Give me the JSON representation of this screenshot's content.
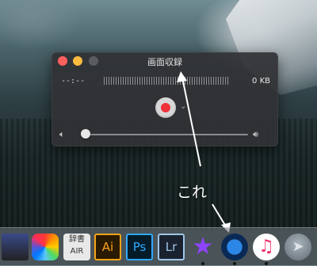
{
  "window": {
    "title": "画面収録",
    "time_display": "--:--",
    "file_size": "0 KB",
    "options_chevron": "⌄",
    "volume": 0.03
  },
  "annotation": {
    "label": "これ"
  },
  "dock": {
    "items": [
      {
        "icon": "screen-app-icon"
      },
      {
        "icon": "pinwheel-icon"
      },
      {
        "icon": "dictionary-icon",
        "text": "辞書 AIR"
      },
      {
        "icon": "illustrator-icon",
        "text": "Ai"
      },
      {
        "icon": "photoshop-icon",
        "text": "Ps"
      },
      {
        "icon": "lightroom-icon",
        "text": "Lr"
      },
      {
        "icon": "imovie-icon"
      },
      {
        "icon": "quicktime-icon"
      },
      {
        "icon": "itunes-icon"
      },
      {
        "icon": "launchpad-icon"
      }
    ]
  },
  "colors": {
    "close": "#fc605c",
    "minimize": "#fdbc40",
    "record": "#f0323a",
    "annotation": "#ffffff"
  }
}
